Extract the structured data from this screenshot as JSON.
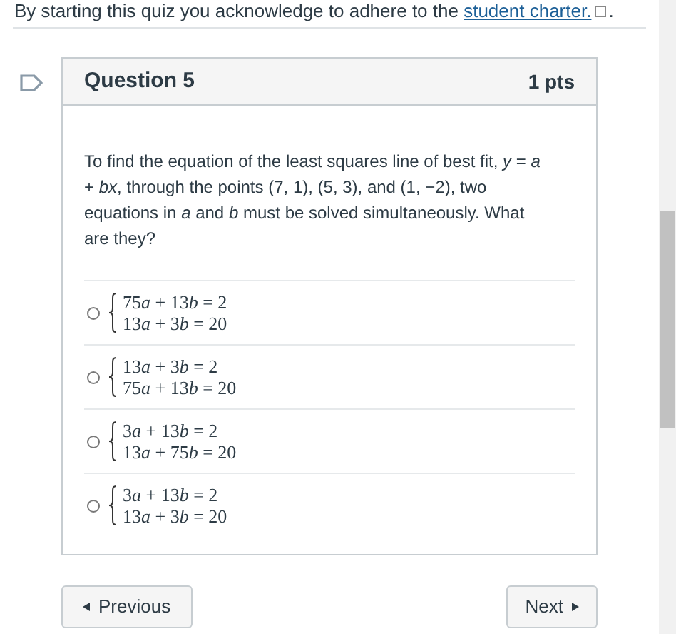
{
  "notice": {
    "text": "By starting this quiz you acknowledge to adhere to the",
    "link": "student charter.",
    "suffix": "."
  },
  "question": {
    "title": "Question 5",
    "points": "1 pts",
    "text": "To find the equation of the least squares line of best fit, *y* = *a* + *bx*, through the points (7, 1), (5, 3), and (1, −2), two equations in *a* and *b* must be solved simultaneously. What are they?",
    "options": [
      {
        "selected": false,
        "lines": [
          "75a + 13b = 2",
          "13a + 3b = 20"
        ]
      },
      {
        "selected": false,
        "lines": [
          "13a + 3b = 2",
          "75a + 13b = 20"
        ]
      },
      {
        "selected": false,
        "lines": [
          "3a + 13b = 2",
          "13a + 75b = 20"
        ]
      },
      {
        "selected": false,
        "lines": [
          "3a + 13b = 2",
          "13a + 3b = 20"
        ]
      }
    ]
  },
  "nav": {
    "previous": "Previous",
    "next": "Next"
  }
}
